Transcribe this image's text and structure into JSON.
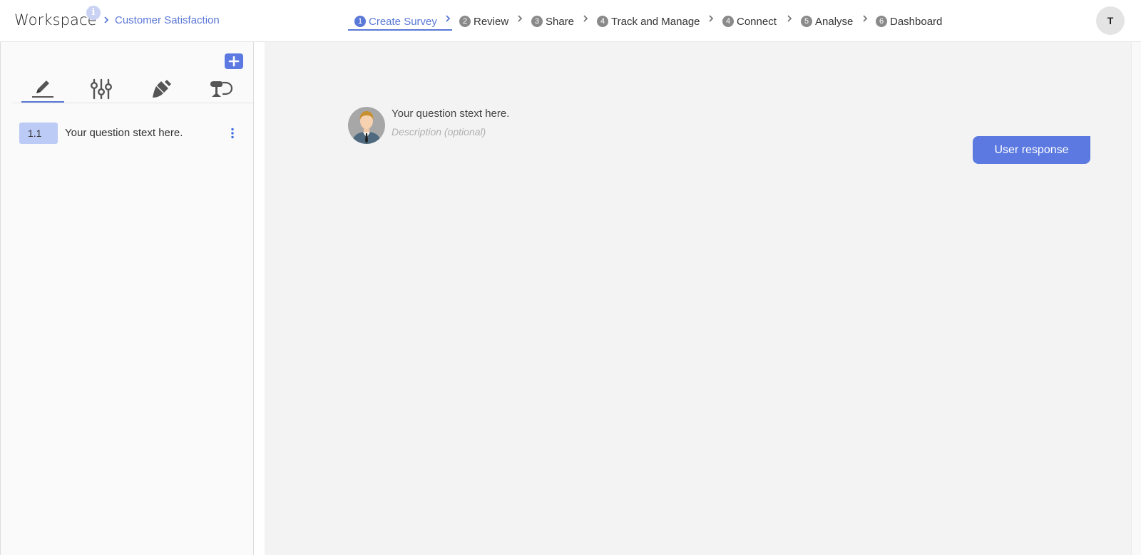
{
  "header": {
    "brand": "Workspace",
    "info_icon": "info-icon",
    "breadcrumb": "Customer Satisfaction",
    "steps": [
      {
        "num": "1",
        "label": "Create Survey"
      },
      {
        "num": "2",
        "label": "Review"
      },
      {
        "num": "3",
        "label": "Share"
      },
      {
        "num": "4",
        "label": "Track and Manage"
      },
      {
        "num": "4",
        "label": "Connect"
      },
      {
        "num": "5",
        "label": "Analyse"
      },
      {
        "num": "6",
        "label": "Dashboard"
      }
    ],
    "active_step": "Create Survey",
    "user_initial": "T"
  },
  "sidebar": {
    "add_icon": "plus-icon",
    "tools": [
      "pencil-icon",
      "sliders-icon",
      "paint-brush-icon",
      "logic-icon"
    ],
    "questions": [
      {
        "num": "1.1",
        "text": "Your question stext here."
      }
    ]
  },
  "main": {
    "question": "Your question stext here.",
    "description_placeholder": "Description (optional)",
    "user_response_label": "User response"
  },
  "colors": {
    "accent": "#5b79e0",
    "link": "#5a78d6",
    "question_badge": "#bccaf6",
    "canvas_bg": "#f3f3f3"
  }
}
